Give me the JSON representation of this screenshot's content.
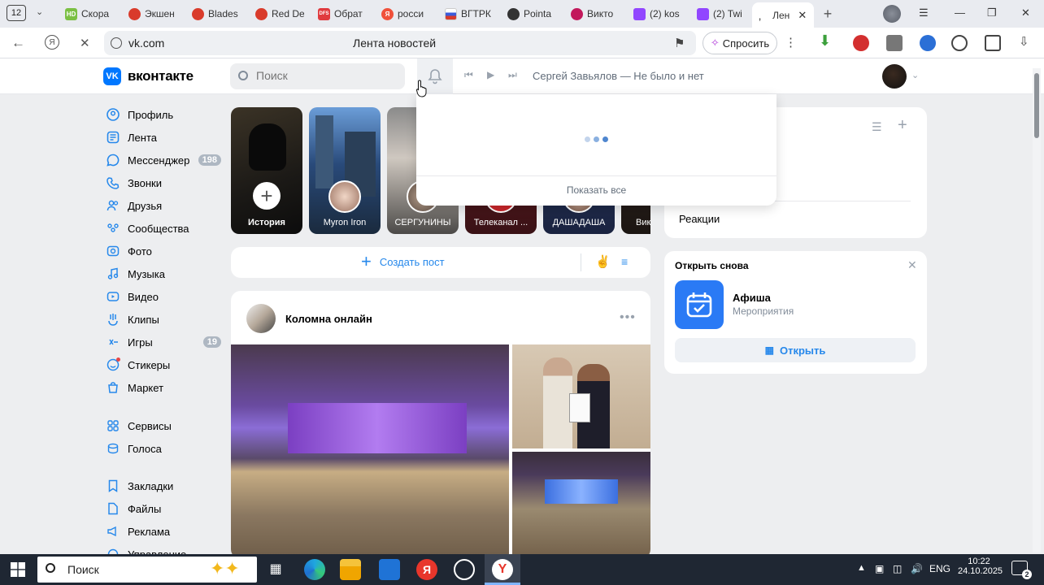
{
  "browser": {
    "tab_count": "12",
    "tabs": [
      {
        "label": "Скора",
        "fav_color": "#7bc043",
        "fav_text": "HD"
      },
      {
        "label": "Экшен",
        "fav_color": "#d93b2b",
        "fav_text": ""
      },
      {
        "label": "Blades",
        "fav_color": "#d93b2b",
        "fav_text": ""
      },
      {
        "label": "Red De",
        "fav_color": "#d93b2b",
        "fav_text": ""
      },
      {
        "label": "Обрат",
        "fav_color": "#e03a3e",
        "fav_text": "DFS"
      },
      {
        "label": "росси",
        "fav_color": "#f0513b",
        "fav_text": "Я"
      },
      {
        "label": "ВГТРК",
        "fav_color": "#3b5bdb",
        "fav_text": ""
      },
      {
        "label": "Pointa",
        "fav_color": "#333333",
        "fav_text": ""
      },
      {
        "label": "Викто",
        "fav_color": "#c2185b",
        "fav_text": ""
      },
      {
        "label": "(2) kos",
        "fav_color": "#9146ff",
        "fav_text": ""
      },
      {
        "label": "(2) Twi",
        "fav_color": "#9146ff",
        "fav_text": ""
      }
    ],
    "active_tab": {
      "label": "Лен"
    },
    "url": "vk.com",
    "page_title": "Лента новостей",
    "ask_label": "Спросить"
  },
  "vk": {
    "brand": "вконтакте",
    "search_placeholder": "Поиск",
    "now_playing": "Сергей Завьялов — Не было и нет",
    "menu": [
      {
        "label": "Профиль",
        "icon": "profile-icon"
      },
      {
        "label": "Лента",
        "icon": "news-icon"
      },
      {
        "label": "Мессенджер",
        "icon": "messenger-icon",
        "count": "198"
      },
      {
        "label": "Звонки",
        "icon": "phone-icon"
      },
      {
        "label": "Друзья",
        "icon": "friends-icon"
      },
      {
        "label": "Сообщества",
        "icon": "communities-icon"
      },
      {
        "label": "Фото",
        "icon": "photo-icon"
      },
      {
        "label": "Музыка",
        "icon": "music-icon"
      },
      {
        "label": "Видео",
        "icon": "video-icon"
      },
      {
        "label": "Клипы",
        "icon": "clips-icon"
      },
      {
        "label": "Игры",
        "icon": "games-icon",
        "count": "19"
      },
      {
        "label": "Стикеры",
        "icon": "stickers-icon"
      },
      {
        "label": "Маркет",
        "icon": "market-icon"
      },
      {
        "label": "Сервисы",
        "icon": "services-icon"
      },
      {
        "label": "Голоса",
        "icon": "votes-icon"
      },
      {
        "label": "Закладки",
        "icon": "bookmarks-icon"
      },
      {
        "label": "Файлы",
        "icon": "files-icon"
      },
      {
        "label": "Реклама",
        "icon": "ads-icon"
      },
      {
        "label": "Управление",
        "icon": "manage-icon"
      }
    ],
    "stories": [
      {
        "label": "История"
      },
      {
        "label": "Myron Iron"
      },
      {
        "label": "СЕРГУНИНЫ"
      },
      {
        "label": "Телеканал ..."
      },
      {
        "label": "ДАШАДАША"
      },
      {
        "label": "Вик"
      }
    ],
    "create_post": "Создать пост",
    "post": {
      "author": "Коломна онлайн"
    },
    "notifications": {
      "show_all": "Показать все"
    },
    "right_panel": {
      "reactions": "Реакции"
    },
    "reopen": {
      "title": "Открыть снова",
      "app_name": "Афиша",
      "app_subtitle": "Мероприятия",
      "open_label": "Открыть"
    },
    "accent": "#0077ff"
  },
  "taskbar": {
    "search_label": "Поиск",
    "lang": "ENG",
    "time": "10:22",
    "date": "24.10.2025",
    "notification_count": "2"
  }
}
